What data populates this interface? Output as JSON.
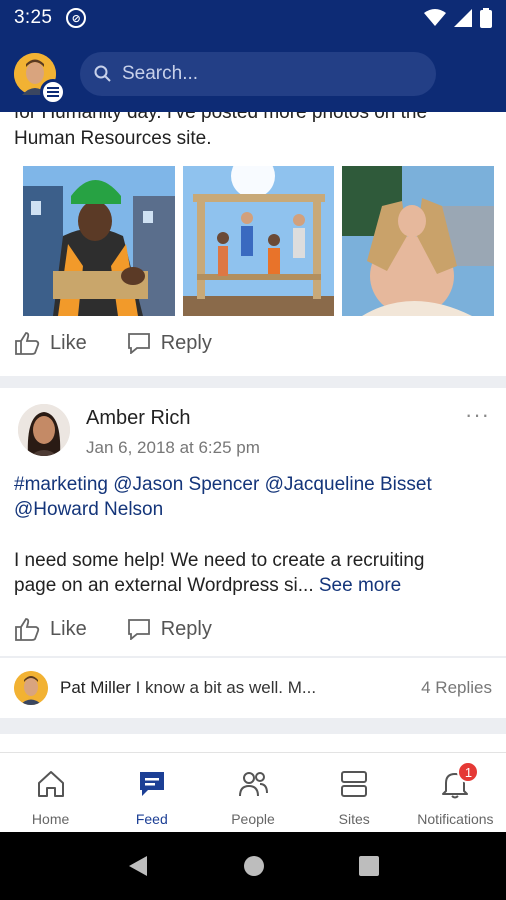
{
  "status_bar": {
    "time": "3:25"
  },
  "header": {
    "search_placeholder": "Search..."
  },
  "feed": {
    "post1": {
      "text_line1": "for Humanity day. I've posted more photos on the",
      "text_line2": "Human Resources site.",
      "like_label": "Like",
      "reply_label": "Reply"
    },
    "post2": {
      "author": "Amber Rich",
      "date": "Jan 6, 2018 at 6:25 pm",
      "tags_line1": "#marketing @Jason Spencer @Jacqueline Bisset",
      "tags_line2": "@Howard Nelson",
      "body_line1": "I need some help! We need to create a recruiting",
      "body_line2": "page on an external Wordpress si...",
      "see_more": "See more",
      "like_label": "Like",
      "reply_label": "Reply"
    },
    "reply_preview": {
      "author": "Pat Miller",
      "snippet": "I know a bit as well.  M...",
      "reply_count": "4 Replies"
    }
  },
  "tabs": [
    {
      "label": "Home",
      "icon": "home-icon"
    },
    {
      "label": "Feed",
      "icon": "feed-icon",
      "active": true
    },
    {
      "label": "People",
      "icon": "people-icon"
    },
    {
      "label": "Sites",
      "icon": "sites-icon"
    },
    {
      "label": "Notifications",
      "icon": "bell-icon",
      "badge": "1"
    }
  ],
  "colors": {
    "brand_navy": "#0d2b75",
    "link_blue": "#14357a",
    "badge_red": "#e53935"
  }
}
